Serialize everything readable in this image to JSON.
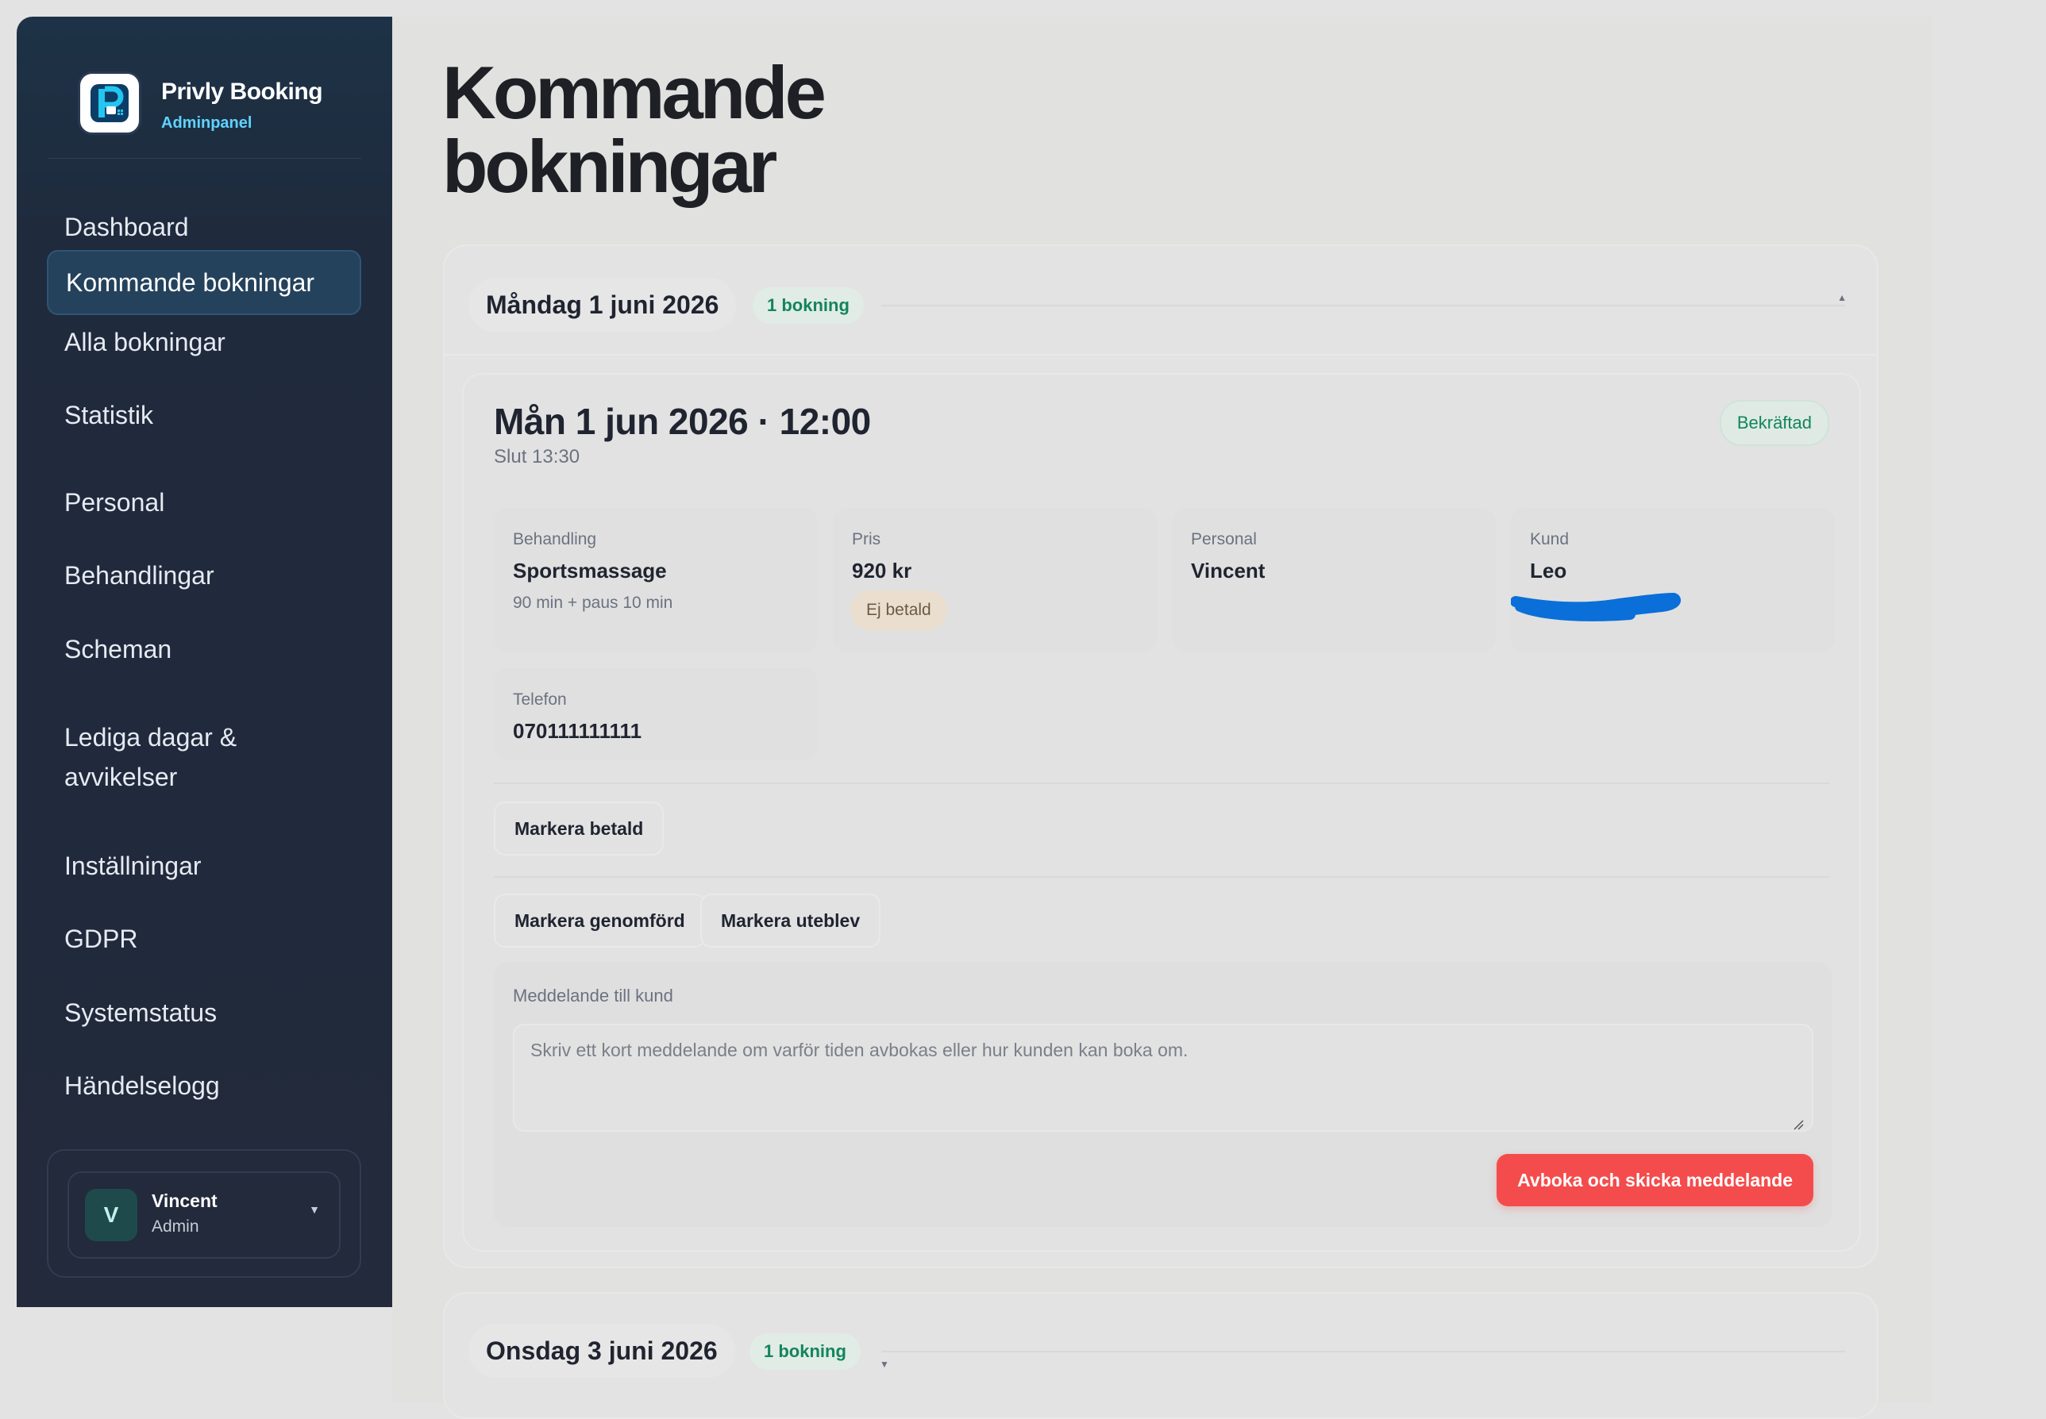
{
  "brand": {
    "name": "Privly Booking",
    "subtitle": "Adminpanel"
  },
  "sidebar": {
    "items": [
      {
        "label": "Dashboard",
        "active": false
      },
      {
        "label": "Kommande bokningar",
        "active": true
      },
      {
        "label": "Alla bokningar",
        "active": false
      },
      {
        "label": "Statistik",
        "active": false
      },
      {
        "label": "Personal",
        "active": false
      },
      {
        "label": "Behandlingar",
        "active": false
      },
      {
        "label": "Scheman",
        "active": false
      },
      {
        "label": "Lediga dagar & avvikelser",
        "active": false
      },
      {
        "label": "Inställningar",
        "active": false
      },
      {
        "label": "GDPR",
        "active": false
      },
      {
        "label": "Systemstatus",
        "active": false
      },
      {
        "label": "Händelselogg",
        "active": false
      }
    ],
    "user": {
      "initial": "V",
      "name": "Vincent",
      "role": "Admin"
    }
  },
  "main": {
    "title": "Kommande bokningar",
    "days": [
      {
        "title": "Måndag 1 juni 2026",
        "count": "1 bokning",
        "expanded": true,
        "booking": {
          "title": "Mån 1 jun 2026 · 12:00",
          "end": "Slut 13:30",
          "status": "Bekräftad",
          "tiles": {
            "treatment": {
              "label": "Behandling",
              "value": "Sportsmassage",
              "note": "90 min + paus 10 min"
            },
            "price": {
              "label": "Pris",
              "value": "920 kr",
              "badge": "Ej betald"
            },
            "staff": {
              "label": "Personal",
              "value": "Vincent"
            },
            "customer": {
              "label": "Kund",
              "value": "Leo"
            },
            "phone": {
              "label": "Telefon",
              "value": "070111111111"
            }
          },
          "actions": {
            "mark_paid": "Markera betald",
            "mark_done": "Markera genomförd",
            "mark_noshow": "Markera uteblev"
          },
          "message": {
            "label": "Meddelande till kund",
            "placeholder": "Skriv ett kort meddelande om varför tiden avbokas eller hur kunden kan boka om.",
            "value": "",
            "submit": "Avboka och skicka meddelande"
          }
        }
      },
      {
        "title": "Onsdag 3 juni 2026",
        "count": "1 bokning",
        "expanded": false
      }
    ]
  },
  "colors": {
    "sidebar_bg": "#222a3b",
    "accent_cyan": "#5fd3ff",
    "success_green": "#13855b",
    "danger_red": "#f44c4c",
    "scribble_blue": "#0a6fd8"
  }
}
